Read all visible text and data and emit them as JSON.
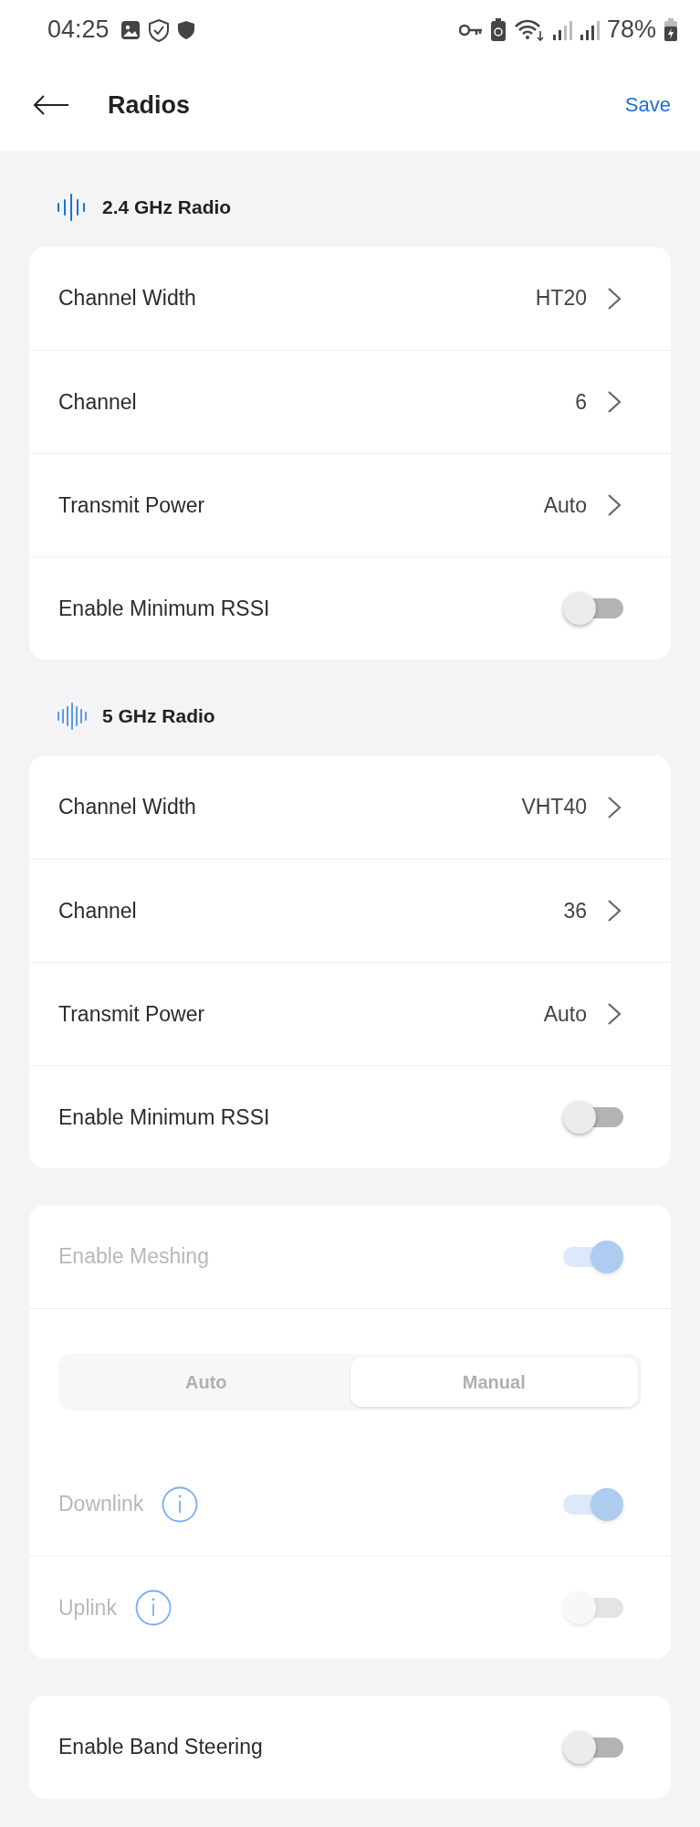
{
  "status_bar": {
    "time": "04:25",
    "battery": "78%"
  },
  "header": {
    "title": "Radios",
    "action": "Save"
  },
  "cards": [
    {
      "title": "2.4 GHz Radio",
      "disabled": false,
      "rows": [
        {
          "kind": "select",
          "label": "Channel Width",
          "value": "HT20"
        },
        {
          "kind": "select",
          "label": "Channel",
          "value": "6"
        },
        {
          "kind": "select",
          "label": "Transmit Power",
          "value": "Auto"
        },
        {
          "kind": "toggle",
          "label": "Enable Minimum RSSI",
          "on": false
        }
      ]
    },
    {
      "title": "5 GHz Radio",
      "disabled": false,
      "rows": [
        {
          "kind": "select",
          "label": "Channel Width",
          "value": "VHT40"
        },
        {
          "kind": "select",
          "label": "Channel",
          "value": "36"
        },
        {
          "kind": "select",
          "label": "Transmit Power",
          "value": "Auto"
        },
        {
          "kind": "toggle",
          "label": "Enable Minimum RSSI",
          "on": false
        }
      ]
    },
    {
      "disabled": true,
      "rows": [
        {
          "kind": "toggle",
          "label": "Enable Meshing",
          "on": true
        },
        {
          "kind": "segmented",
          "options": [
            {
              "label": "Auto",
              "selected": false
            },
            {
              "label": "Manual",
              "selected": true
            }
          ]
        },
        {
          "kind": "toggle",
          "label": "Downlink",
          "info": true,
          "on": true
        },
        {
          "kind": "toggle",
          "label": "Uplink",
          "info": true,
          "on": false
        }
      ]
    },
    {
      "disabled": false,
      "rows": [
        {
          "kind": "toggle",
          "label": "Enable Band Steering",
          "on": false
        }
      ]
    }
  ]
}
